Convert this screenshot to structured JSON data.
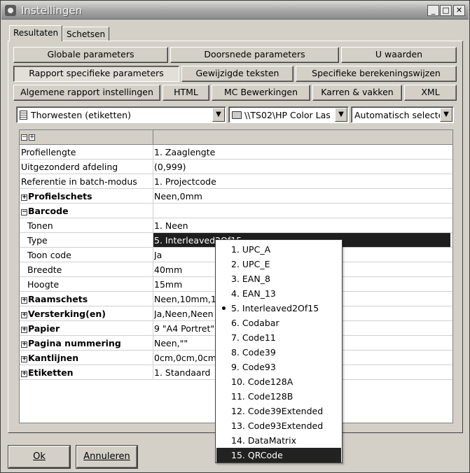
{
  "window": {
    "title": "Instellingen"
  },
  "tabs": [
    "Resultaten",
    "Schetsen"
  ],
  "buttons": {
    "row1": [
      "Globale parameters",
      "Doorsnede parameters",
      "U waarden"
    ],
    "row2": [
      "Rapport specifieke parameters",
      "Gewijzigde teksten",
      "Specifieke berekeningswijzen"
    ],
    "row3": [
      "Algemene rapport instellingen",
      "HTML",
      "MC Bewerkingen",
      "Karren & vakken",
      "XML"
    ]
  },
  "combos": {
    "report": "Thorwesten (etiketten)",
    "printer": "\\\\TS02\\HP Color Las",
    "mode": "Automatisch selecte"
  },
  "grid": {
    "rows": [
      {
        "name": "Profiellengte",
        "value": "1. Zaaglengte"
      },
      {
        "name": "Uitgezonderd afdeling",
        "value": "(0,999)"
      },
      {
        "name": "Referentie in batch-modus",
        "value": "1. Projectcode"
      },
      {
        "name": "Profielschets",
        "value": "Neen,0mm",
        "expander": "+"
      },
      {
        "name": "Barcode",
        "value": "",
        "expander": "−"
      },
      {
        "name": "Tonen",
        "value": "1. Neen"
      },
      {
        "name": "Type",
        "value": "5. Interleaved2Of15"
      },
      {
        "name": "Toon code",
        "value": "Ja"
      },
      {
        "name": "Breedte",
        "value": "40mm"
      },
      {
        "name": "Hoogte",
        "value": "15mm"
      },
      {
        "name": "Raamschets",
        "value": "Neen,10mm,10",
        "expander": "+"
      },
      {
        "name": "Versterking(en)",
        "value": "Ja,Neen,Neen",
        "expander": "+"
      },
      {
        "name": "Papier",
        "value": "9 \"A4 Portret\"",
        "expander": "+"
      },
      {
        "name": "Pagina nummering",
        "value": "Neen,\"\"",
        "expander": "+"
      },
      {
        "name": "Kantlijnen",
        "value": "0cm,0cm,0cm,",
        "expander": "+"
      },
      {
        "name": "Etiketten",
        "value": "1. Standaard",
        "expander": "+"
      }
    ]
  },
  "dropdown": {
    "options": [
      "1. UPC_A",
      "2. UPC_E",
      "3. EAN_8",
      "4. EAN_13",
      "5. Interleaved2Of15",
      "6. Codabar",
      "7. Code11",
      "8. Code39",
      "9. Code93",
      "10. Code128A",
      "11. Code128B",
      "12. Code39Extended",
      "13. Code93Extended",
      "14. DataMatrix",
      "15. QRCode"
    ],
    "current": "5. Interleaved2Of15",
    "highlighted": "15. QRCode"
  },
  "footer": {
    "ok": "Ok",
    "cancel": "Annuleren"
  }
}
